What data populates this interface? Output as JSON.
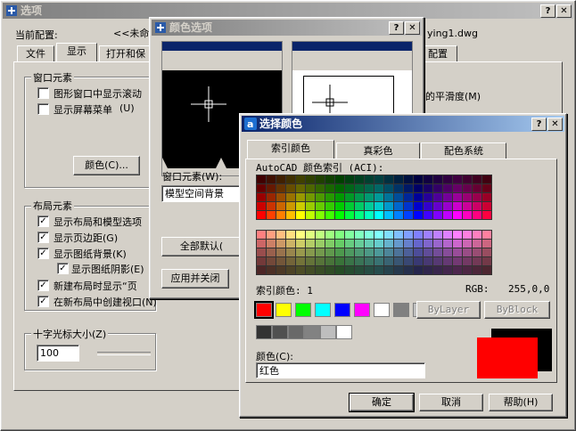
{
  "options": {
    "title": "选项",
    "current_profile_label": "当前配置:",
    "current_profile_value": "<<未命名",
    "current_drawing_value": "ying1.dwg",
    "tabs": [
      "文件",
      "显示",
      "打开和保",
      "配置"
    ],
    "window_elements": {
      "title": "窗口元素",
      "items": [
        "图形窗口中显示滚动",
        "显示屏幕菜单"
      ],
      "shortcuts": [
        "",
        "(U)"
      ],
      "right_text": "的平滑度(M)",
      "colors_button": "颜色(C)..."
    },
    "layout_elements": {
      "title": "布局元素",
      "items": [
        "显示布局和模型选项",
        "显示页边距(G)",
        "显示图纸背景(K)",
        "显示图纸阴影(E)",
        "新建布局时显示“页",
        "在新布局中创建视口(N)"
      ]
    },
    "crosshair": {
      "title": "十字光标大小(Z)",
      "value": "100"
    }
  },
  "color_options": {
    "title": "颜色选项",
    "window_element_label": "窗口元素(W):",
    "window_element_value": "模型空间背景",
    "restore_button": "全部默认(",
    "apply_close_button": "应用并关闭"
  },
  "select_color": {
    "title": "选择颜色",
    "tabs": [
      "索引颜色",
      "真彩色",
      "配色系统"
    ],
    "aci_label": "AutoCAD 颜色索引 (ACI):",
    "index_label": "索引颜色: 1",
    "rgb_label": "RGB:",
    "rgb_value": "255,0,0",
    "bylayer": "ByLayer",
    "byblock": "ByBlock",
    "color_label": "颜色(C):",
    "color_value": "红色",
    "ok": "确定",
    "cancel": "取消",
    "help": "帮助(H)",
    "accent_selected": "#ff0000"
  },
  "icons": [
    "options-app-icon",
    "help-icon",
    "close-icon",
    "autocad-icon",
    "checkmark-icon"
  ]
}
